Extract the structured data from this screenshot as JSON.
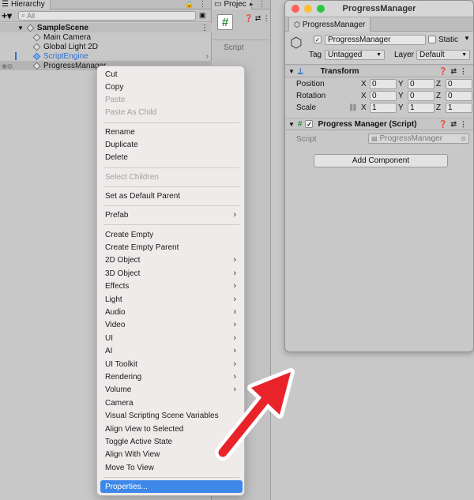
{
  "hierarchy": {
    "tab_label": "Hierarchy",
    "search_placeholder": "All",
    "scene": "SampleScene",
    "items": [
      "Main Camera",
      "Global Light 2D",
      "ScriptEngine",
      "ProgressManager"
    ]
  },
  "project": {
    "tab_label": "Projec",
    "script_label": "Script"
  },
  "inspector": {
    "window_title": "ProgressManager",
    "tab_label": "ProgressManager",
    "object_name": "ProgressManager",
    "static_label": "Static",
    "tag_label": "Tag",
    "tag_value": "Untagged",
    "layer_label": "Layer",
    "layer_value": "Default",
    "transform_title": "Transform",
    "position_label": "Position",
    "rotation_label": "Rotation",
    "scale_label": "Scale",
    "position": [
      "0",
      "0",
      "0"
    ],
    "rotation": [
      "0",
      "0",
      "0"
    ],
    "scale": [
      "1",
      "1",
      "1"
    ],
    "axes": [
      "X",
      "Y",
      "Z"
    ],
    "script_component_title": "Progress Manager (Script)",
    "script_field_label": "Script",
    "script_field_value": "ProgressManager",
    "add_component_label": "Add Component"
  },
  "menu": {
    "items": [
      {
        "label": "Cut"
      },
      {
        "label": "Copy"
      },
      {
        "label": "Paste",
        "disabled": true
      },
      {
        "label": "Paste As Child",
        "disabled": true
      },
      {
        "label": "Rename"
      },
      {
        "label": "Duplicate"
      },
      {
        "label": "Delete"
      },
      {
        "label": "Select Children",
        "disabled": true
      },
      {
        "label": "Set as Default Parent"
      },
      {
        "label": "Prefab",
        "submenu": true
      },
      {
        "label": "Create Empty"
      },
      {
        "label": "Create Empty Parent"
      },
      {
        "label": "2D Object",
        "submenu": true
      },
      {
        "label": "3D Object",
        "submenu": true
      },
      {
        "label": "Effects",
        "submenu": true
      },
      {
        "label": "Light",
        "submenu": true
      },
      {
        "label": "Audio",
        "submenu": true
      },
      {
        "label": "Video",
        "submenu": true
      },
      {
        "label": "UI",
        "submenu": true
      },
      {
        "label": "AI",
        "submenu": true
      },
      {
        "label": "UI Toolkit",
        "submenu": true
      },
      {
        "label": "Rendering",
        "submenu": true
      },
      {
        "label": "Volume",
        "submenu": true
      },
      {
        "label": "Camera"
      },
      {
        "label": "Visual Scripting Scene Variables"
      },
      {
        "label": "Align View to Selected"
      },
      {
        "label": "Toggle Active State"
      },
      {
        "label": "Align With View"
      },
      {
        "label": "Move To View"
      },
      {
        "label": "Properties...",
        "highlighted": true
      }
    ]
  },
  "colors": {
    "highlight": "#3d88e8",
    "arrow": "#e8232a",
    "script_link": "#2c6fd1"
  }
}
